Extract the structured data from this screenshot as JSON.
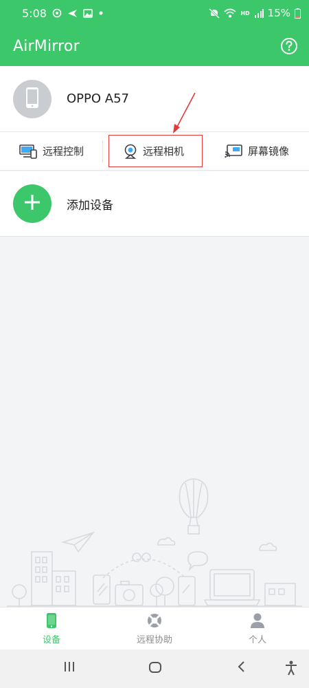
{
  "status_bar": {
    "time": "5:08",
    "battery": "15%",
    "network_tag": "HD"
  },
  "app_bar": {
    "title": "AirMirror",
    "help_icon": "question-circle-icon"
  },
  "device": {
    "name": "OPPO A57"
  },
  "actions": [
    {
      "label": "远程控制",
      "icon": "remote-control-icon"
    },
    {
      "label": "远程相机",
      "icon": "webcam-icon"
    },
    {
      "label": "屏幕镜像",
      "icon": "cast-screen-icon"
    }
  ],
  "add_device": {
    "label": "添加设备"
  },
  "bottom_nav": [
    {
      "label": "设备",
      "icon": "phone-icon",
      "active": true
    },
    {
      "label": "远程协助",
      "icon": "lifebuoy-icon",
      "active": false
    },
    {
      "label": "个人",
      "icon": "person-icon",
      "active": false
    }
  ],
  "colors": {
    "brand": "#3dc76b",
    "annotation": "#e23a3a",
    "background": "#f2f4f6"
  }
}
